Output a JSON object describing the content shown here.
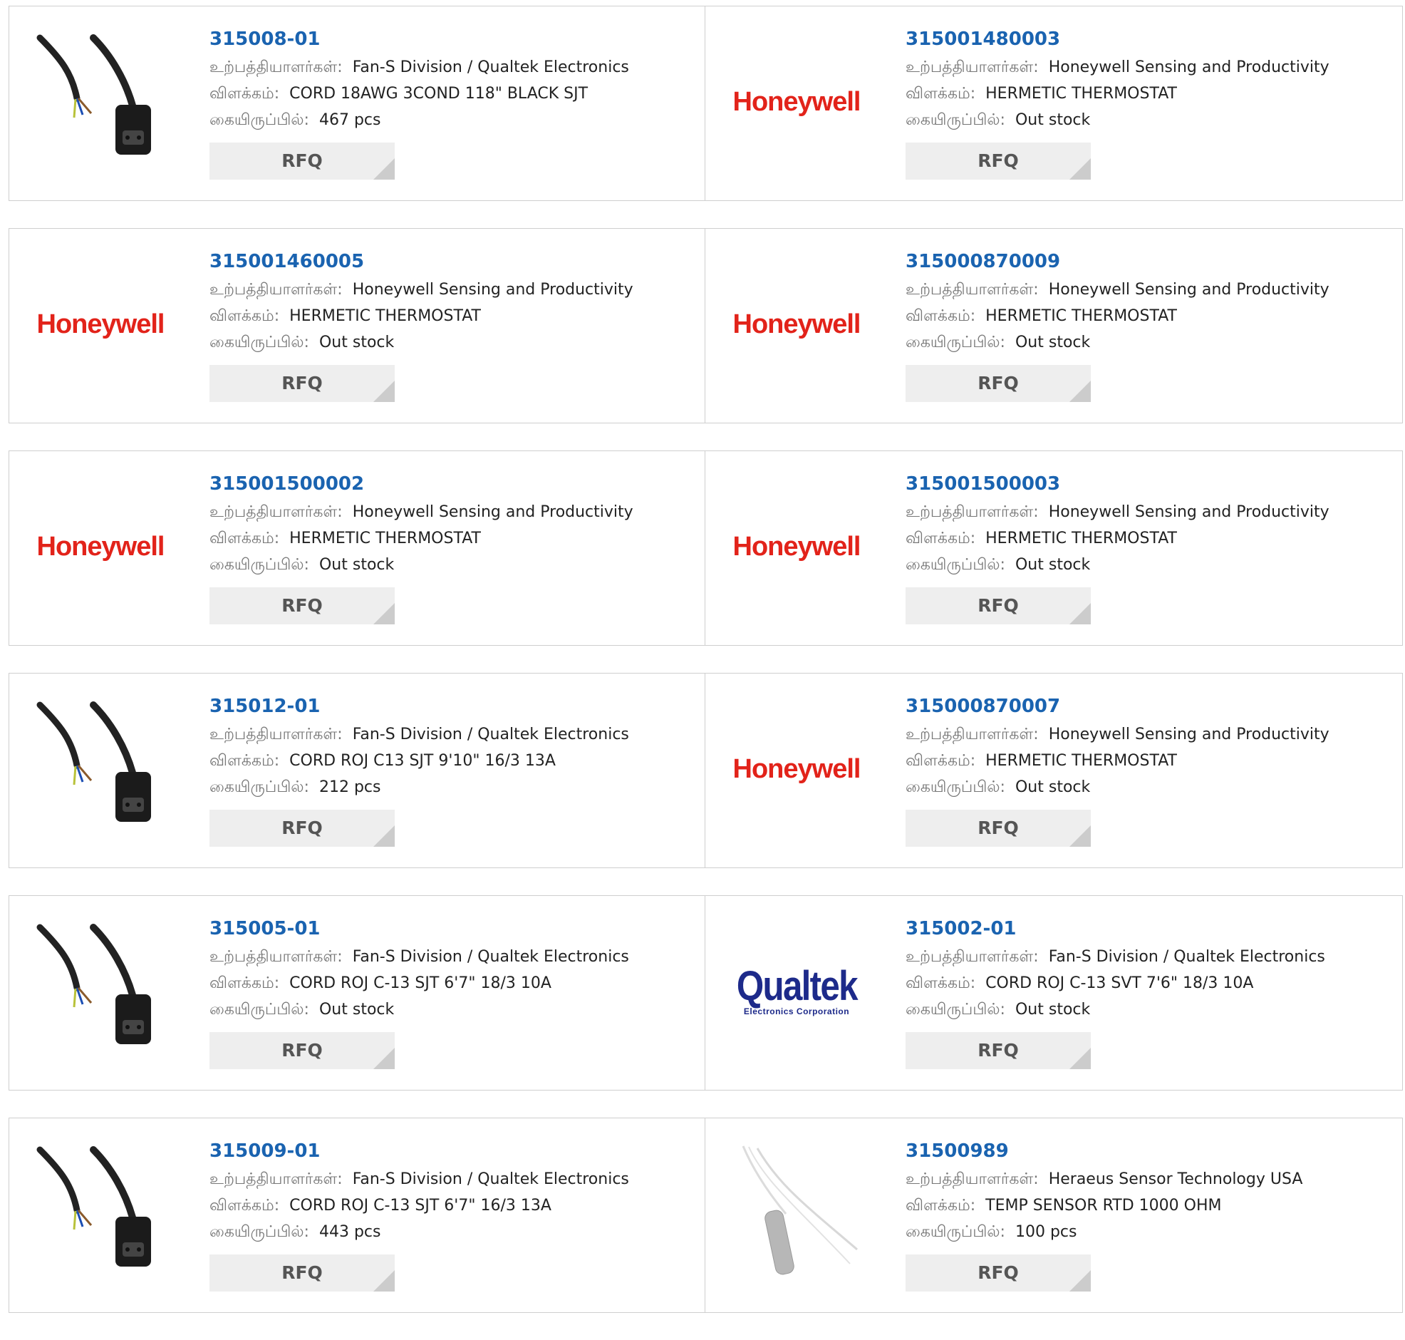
{
  "labels": {
    "manufacturer": "உற்பத்தியாளர்கள்:",
    "description": "விளக்கம்:",
    "stock": "கையிருப்பில்:",
    "rfq": "RFQ"
  },
  "colors": {
    "part_link": "#1a63b0",
    "honeywell_red": "#e2231a",
    "qualtek_blue": "#1d2a8a",
    "rfq_bg": "#eeeeee"
  },
  "products": [
    {
      "part": "315008-01",
      "manufacturer": "Fan-S Division / Qualtek Electronics",
      "description": "CORD 18AWG 3COND 118\" BLACK SJT",
      "stock": "467 pcs",
      "image": "power-cord-image"
    },
    {
      "part": "315001480003",
      "manufacturer": "Honeywell Sensing and Productivity",
      "description": "HERMETIC THERMOSTAT",
      "stock": "Out stock",
      "image": "honeywell-logo",
      "logo_text": "Honeywell"
    },
    {
      "part": "315001460005",
      "manufacturer": "Honeywell Sensing and Productivity",
      "description": "HERMETIC THERMOSTAT",
      "stock": "Out stock",
      "image": "honeywell-logo",
      "logo_text": "Honeywell"
    },
    {
      "part": "315000870009",
      "manufacturer": "Honeywell Sensing and Productivity",
      "description": "HERMETIC THERMOSTAT",
      "stock": "Out stock",
      "image": "honeywell-logo",
      "logo_text": "Honeywell"
    },
    {
      "part": "315001500002",
      "manufacturer": "Honeywell Sensing and Productivity",
      "description": "HERMETIC THERMOSTAT",
      "stock": "Out stock",
      "image": "honeywell-logo",
      "logo_text": "Honeywell"
    },
    {
      "part": "315001500003",
      "manufacturer": "Honeywell Sensing and Productivity",
      "description": "HERMETIC THERMOSTAT",
      "stock": "Out stock",
      "image": "honeywell-logo",
      "logo_text": "Honeywell"
    },
    {
      "part": "315012-01",
      "manufacturer": "Fan-S Division / Qualtek Electronics",
      "description": "CORD ROJ C13 SJT 9'10\" 16/3 13A",
      "stock": "212 pcs",
      "image": "power-cord-image"
    },
    {
      "part": "315000870007",
      "manufacturer": "Honeywell Sensing and Productivity",
      "description": "HERMETIC THERMOSTAT",
      "stock": "Out stock",
      "image": "honeywell-logo",
      "logo_text": "Honeywell"
    },
    {
      "part": "315005-01",
      "manufacturer": "Fan-S Division / Qualtek Electronics",
      "description": "CORD ROJ C-13 SJT 6'7\" 18/3 10A",
      "stock": "Out stock",
      "image": "power-cord-image"
    },
    {
      "part": "315002-01",
      "manufacturer": "Fan-S Division / Qualtek Electronics",
      "description": "CORD ROJ C-13 SVT 7'6\" 18/3 10A",
      "stock": "Out stock",
      "image": "qualtek-logo",
      "logo_text": "Qualtek",
      "logo_subtext": "Electronics Corporation"
    },
    {
      "part": "315009-01",
      "manufacturer": "Fan-S Division / Qualtek Electronics",
      "description": "CORD ROJ C-13 SJT 6'7\" 16/3 13A",
      "stock": "443 pcs",
      "image": "power-cord-image"
    },
    {
      "part": "31500989",
      "manufacturer": "Heraeus Sensor Technology USA",
      "description": "TEMP SENSOR RTD 1000 OHM",
      "stock": "100 pcs",
      "image": "temp-sensor-image"
    }
  ]
}
